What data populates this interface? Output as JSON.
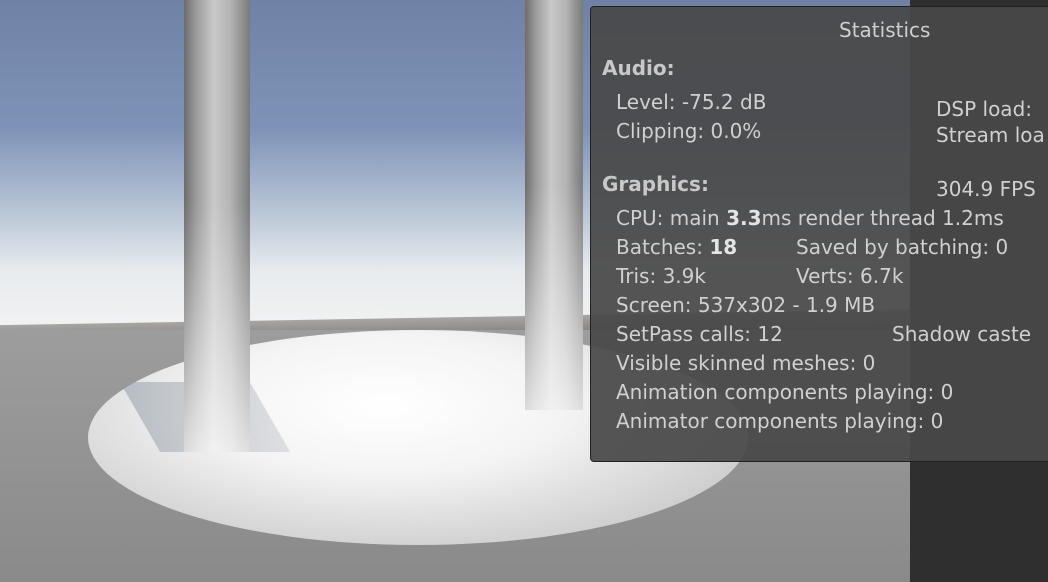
{
  "panel": {
    "title": "Statistics"
  },
  "audio": {
    "header": "Audio:",
    "level": "Level: -75.2 dB",
    "clipping": "Clipping: 0.0%",
    "dsp_load": "DSP load:",
    "stream_load": "Stream loa"
  },
  "graphics": {
    "header": "Graphics:",
    "fps": "304.9 FPS",
    "cpu_prefix": "CPU: main ",
    "cpu_main": "3.3",
    "cpu_suffix": "ms  render thread 1.2ms",
    "batches_prefix": "Batches: ",
    "batches_value": "18",
    "saved_by_batching": "Saved by batching: 0",
    "tris": "Tris: 3.9k",
    "verts": "Verts: 6.7k",
    "screen": "Screen: 537x302 - 1.9 MB",
    "setpass": "SetPass calls: 12",
    "shadow_casters": "Shadow caste",
    "visible_skinned": "Visible skinned meshes: 0",
    "animation_components": "Animation components playing: 0",
    "animator_components": "Animator components playing: 0"
  }
}
